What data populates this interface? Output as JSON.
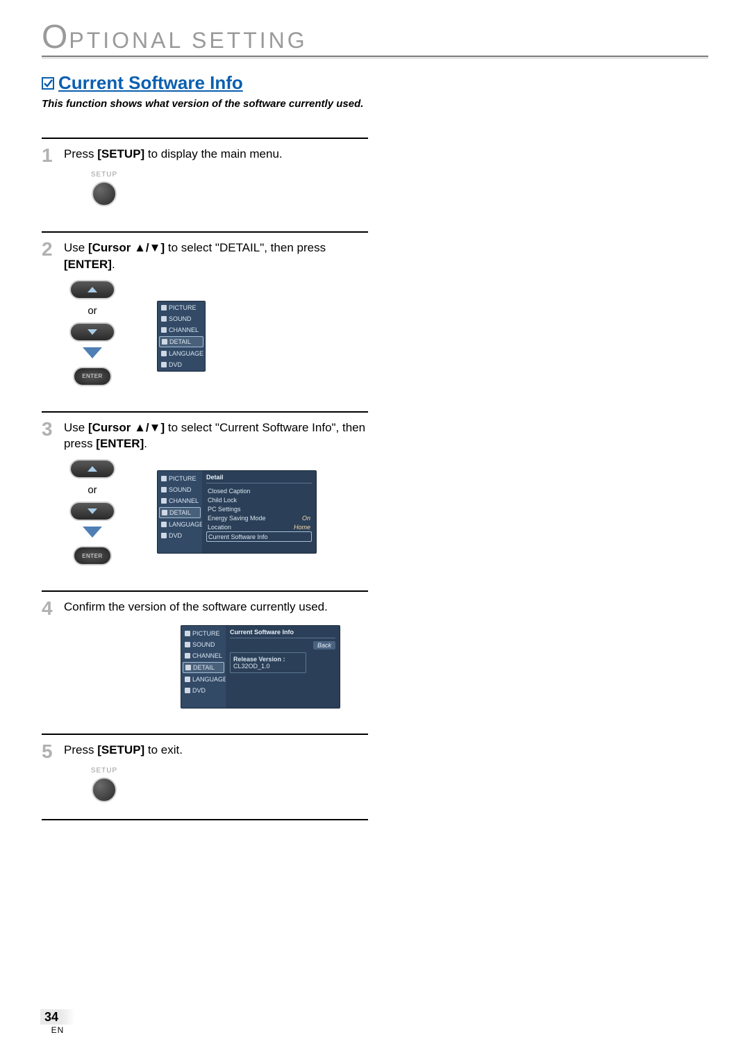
{
  "page_header": {
    "leading_char": "O",
    "rest": "PTIONAL  SETTING"
  },
  "section": {
    "heading": "Current Software Info",
    "description": "This function shows what version of the software currently used."
  },
  "steps": {
    "s1": {
      "num": "1",
      "pre": "Press ",
      "key": "[SETUP]",
      "post": " to display the main menu.",
      "button_label": "SETUP"
    },
    "s2": {
      "num": "2",
      "t_use": "Use ",
      "t_cursor": "[Cursor ",
      "t_sep": "/",
      "t_close": "]",
      "t_post": " to select \"DETAIL\", then press ",
      "t_enter": "[ENTER]",
      "t_period": ".",
      "or": "or",
      "enter_label": "ENTER",
      "osd_items": [
        "PICTURE",
        "SOUND",
        "CHANNEL",
        "DETAIL",
        "LANGUAGE",
        "DVD"
      ]
    },
    "s3": {
      "num": "3",
      "t_use": "Use ",
      "t_cursor": "[Cursor ",
      "t_sep": "/",
      "t_close": "]",
      "t_post": " to select \"Current Software Info\", then press ",
      "t_enter": "[ENTER]",
      "t_period": ".",
      "or": "or",
      "enter_label": "ENTER",
      "osd_title": "Detail",
      "osd_items": [
        "PICTURE",
        "SOUND",
        "CHANNEL",
        "DETAIL",
        "LANGUAGE",
        "DVD"
      ],
      "content_rows": [
        {
          "label": "Closed Caption",
          "value": ""
        },
        {
          "label": "Child Lock",
          "value": ""
        },
        {
          "label": "PC Settings",
          "value": ""
        },
        {
          "label": "Energy Saving Mode",
          "value": "On"
        },
        {
          "label": "Location",
          "value": "Home"
        },
        {
          "label": "Current Software Info",
          "value": "",
          "sel": true
        }
      ]
    },
    "s4": {
      "num": "4",
      "text": "Confirm the version of the software currently used.",
      "osd_title": "Current Software Info",
      "osd_items": [
        "PICTURE",
        "SOUND",
        "CHANNEL",
        "DETAIL",
        "LANGUAGE",
        "DVD"
      ],
      "back_label": "Back",
      "release_label": "Release Version :",
      "release_value": "CL32OD_1.0"
    },
    "s5": {
      "num": "5",
      "pre": "Press ",
      "key": "[SETUP]",
      "post": " to exit.",
      "button_label": "SETUP"
    }
  },
  "footer": {
    "page_num": "34",
    "lang": "EN"
  }
}
